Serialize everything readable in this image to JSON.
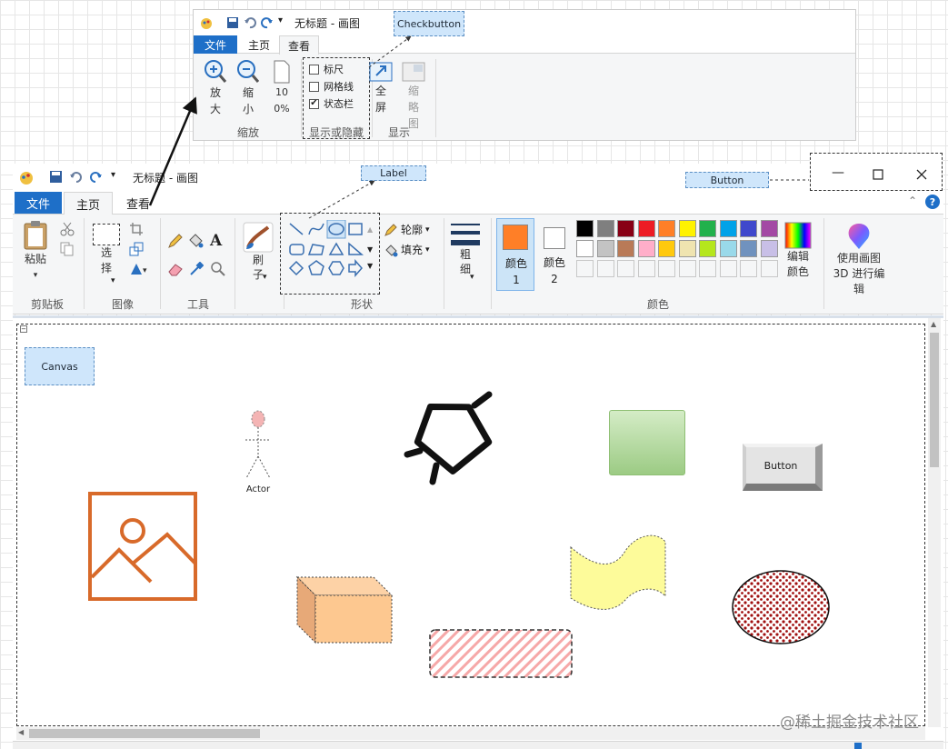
{
  "callouts": {
    "checkbutton": "Checkbutton",
    "label": "Label",
    "button": "Button",
    "canvas": "Canvas"
  },
  "inset": {
    "title": "无标题 - 画图",
    "tabs": [
      "文件",
      "主页",
      "查看"
    ],
    "zoom_in": "放大",
    "zoom_out": "缩小",
    "zoom_100": "100%",
    "group_zoom": "缩放",
    "cb_ruler": "标尺",
    "cb_grid": "网格线",
    "cb_status": "状态栏",
    "group_showhide": "显示或隐藏",
    "fullscreen": "全屏",
    "thumbnail": "缩略图",
    "group_display": "显示"
  },
  "main": {
    "title": "无标题 - 画图",
    "tabs": [
      "文件",
      "主页",
      "查看"
    ],
    "paste": "粘贴",
    "group_clipboard": "剪贴板",
    "select": "选择",
    "group_image": "图像",
    "group_tools": "工具",
    "brush": "刷子",
    "group_shapes": "形状",
    "outline": "轮廓",
    "fill": "填充",
    "size": "粗细",
    "color1": "颜色 1",
    "color2": "颜色 2",
    "edit_colors": "编辑颜色",
    "paint3d": "使用画图 3D 进行编辑",
    "group_colors": "颜色"
  },
  "palette": {
    "row1": [
      "#000000",
      "#7f7f7f",
      "#880015",
      "#ed1c24",
      "#ff7f27",
      "#fff200",
      "#22b14c",
      "#00a2e8",
      "#3f48cc",
      "#a349a4"
    ],
    "row2": [
      "#ffffff",
      "#c3c3c3",
      "#b97a57",
      "#ffaec9",
      "#ffc90e",
      "#efe4b0",
      "#b5e61d",
      "#99d9ea",
      "#7092be",
      "#c8bfe7"
    ],
    "color1_value": "#ff7f27",
    "color2_value": "#ffffff"
  },
  "canvas": {
    "actor_label": "Actor",
    "button_label": "Button"
  },
  "watermark": "@稀土掘金技术社区"
}
